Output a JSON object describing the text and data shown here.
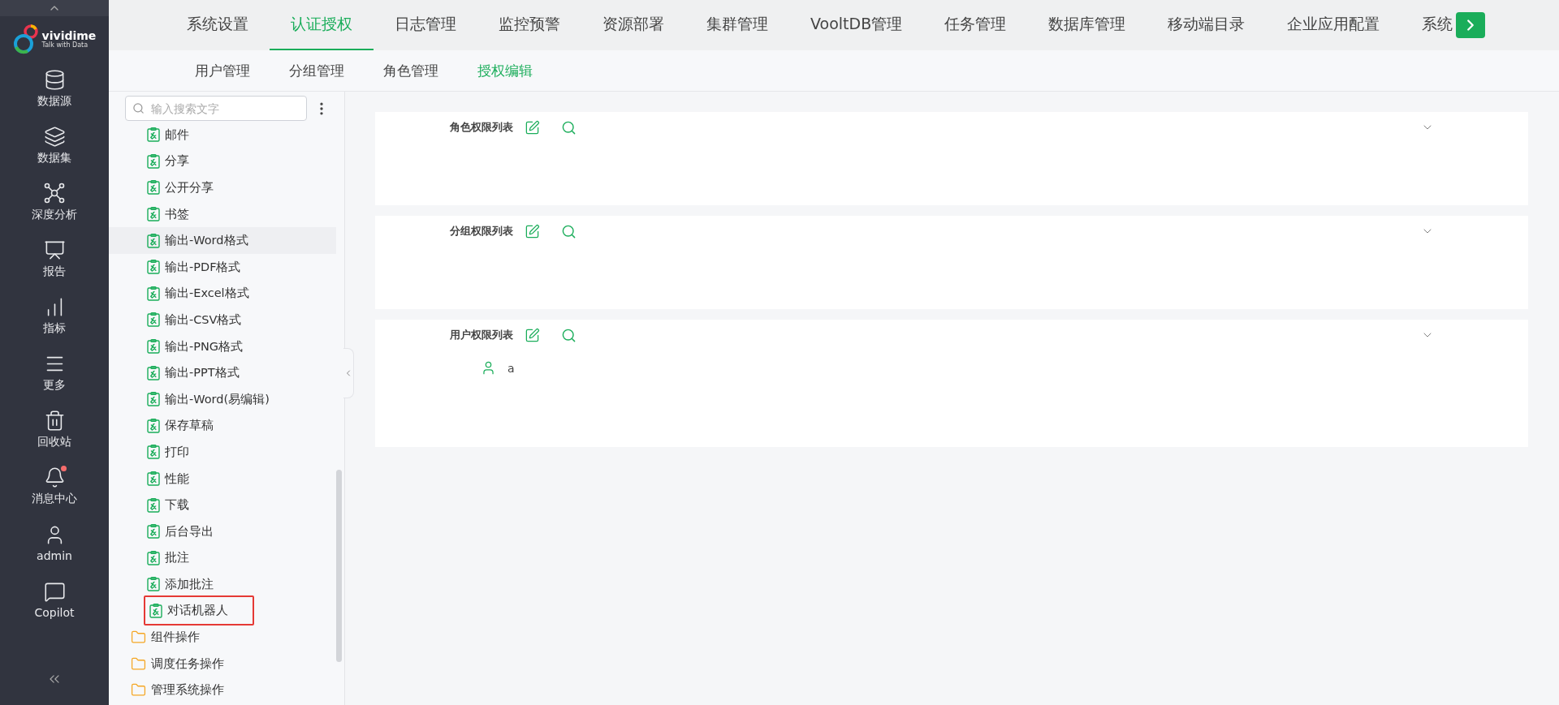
{
  "logo": {
    "name": "vividime",
    "tagline": "Talk with Data"
  },
  "sidebar": {
    "items": [
      {
        "label": "数据源",
        "badge": false
      },
      {
        "label": "数据集",
        "badge": false
      },
      {
        "label": "深度分析",
        "badge": false
      },
      {
        "label": "报告",
        "badge": false
      },
      {
        "label": "指标",
        "badge": false
      },
      {
        "label": "更多",
        "badge": false
      },
      {
        "label": "回收站",
        "badge": false
      },
      {
        "label": "消息中心",
        "badge": true
      },
      {
        "label": "admin",
        "badge": false
      },
      {
        "label": "Copilot",
        "badge": false
      }
    ]
  },
  "top_tabs": [
    {
      "label": "系统设置",
      "selected": false
    },
    {
      "label": "认证授权",
      "selected": true
    },
    {
      "label": "日志管理",
      "selected": false
    },
    {
      "label": "监控预警",
      "selected": false
    },
    {
      "label": "资源部署",
      "selected": false
    },
    {
      "label": "集群管理",
      "selected": false
    },
    {
      "label": "VooltDB管理",
      "selected": false
    },
    {
      "label": "任务管理",
      "selected": false
    },
    {
      "label": "数据库管理",
      "selected": false
    },
    {
      "label": "移动端目录",
      "selected": false
    },
    {
      "label": "企业应用配置",
      "selected": false
    },
    {
      "label": "系统",
      "selected": false
    }
  ],
  "sub_tabs": [
    {
      "label": "用户管理",
      "selected": false
    },
    {
      "label": "分组管理",
      "selected": false
    },
    {
      "label": "角色管理",
      "selected": false
    },
    {
      "label": "授权编辑",
      "selected": true
    }
  ],
  "tree": {
    "search": {
      "placeholder": "输入搜索文字"
    },
    "items": [
      {
        "children": [
          {
            "label": "邮件",
            "highlighted": false,
            "marked": false
          },
          {
            "label": "分享",
            "highlighted": false,
            "marked": false
          },
          {
            "label": "公开分享",
            "highlighted": false,
            "marked": false
          },
          {
            "label": "书签",
            "highlighted": false,
            "marked": false
          },
          {
            "label": "输出-Word格式",
            "highlighted": true,
            "marked": false
          },
          {
            "label": "输出-PDF格式",
            "highlighted": false,
            "marked": false
          },
          {
            "label": "输出-Excel格式",
            "highlighted": false,
            "marked": false
          },
          {
            "label": "输出-CSV格式",
            "highlighted": false,
            "marked": false
          },
          {
            "label": "输出-PNG格式",
            "highlighted": false,
            "marked": false
          },
          {
            "label": "输出-PPT格式",
            "highlighted": false,
            "marked": false
          },
          {
            "label": "输出-Word(易编辑)",
            "highlighted": false,
            "marked": false
          },
          {
            "label": "保存草稿",
            "highlighted": false,
            "marked": false
          },
          {
            "label": "打印",
            "highlighted": false,
            "marked": false
          },
          {
            "label": "性能",
            "highlighted": false,
            "marked": false
          },
          {
            "label": "下载",
            "highlighted": false,
            "marked": false
          },
          {
            "label": "后台导出",
            "highlighted": false,
            "marked": false
          },
          {
            "label": "批注",
            "highlighted": false,
            "marked": false
          },
          {
            "label": "添加批注",
            "highlighted": false,
            "marked": false
          },
          {
            "label": "对话机器人",
            "highlighted": false,
            "marked": true
          }
        ]
      },
      {
        "label": "组件操作"
      },
      {
        "label": "调度任务操作"
      },
      {
        "label": "管理系统操作"
      }
    ]
  },
  "cards": [
    {
      "title": "角色权限列表"
    },
    {
      "title": "分组权限列表"
    },
    {
      "title": "用户权限列表",
      "entries": [
        {
          "name": "a"
        }
      ]
    }
  ]
}
